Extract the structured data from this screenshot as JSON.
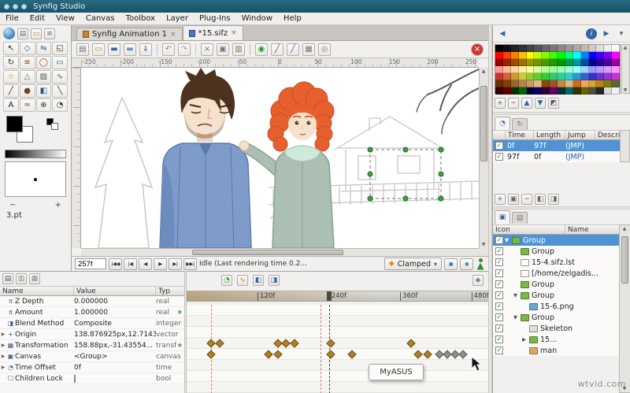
{
  "window": {
    "title": "Synfig Studio"
  },
  "colors": {
    "titlebar": "#1c5a70",
    "selection": "#4f93d6",
    "waypoint": "#b07f28",
    "waypoint_selected": "#8f8f8f",
    "group_icon": "#7ab648"
  },
  "menu": {
    "items": [
      "File",
      "Edit",
      "View",
      "Canvas",
      "Toolbox",
      "Layer",
      "Plug-Ins",
      "Window",
      "Help"
    ]
  },
  "canvas_tabs": [
    {
      "label": "Synfig Animation 1",
      "close": "×"
    },
    {
      "label": "*15.sifz",
      "close": "×"
    }
  ],
  "toolbox": {
    "actions": [
      {
        "name": "new-file",
        "glyph": "▤",
        "color": "#607080"
      },
      {
        "name": "open-file",
        "glyph": "▭",
        "color": "#c08830"
      },
      {
        "name": "settings",
        "glyph": "≡",
        "color": "#666666"
      }
    ],
    "tools": [
      {
        "name": "transform",
        "glyph": "↖",
        "color": "#222222"
      },
      {
        "name": "smooth-move",
        "glyph": "◇",
        "color": "#335588"
      },
      {
        "name": "mirror",
        "glyph": "⇋",
        "color": "#335588"
      },
      {
        "name": "scale",
        "glyph": "◱",
        "color": "#333333"
      },
      {
        "name": "rotate",
        "glyph": "↻",
        "color": "#333333"
      },
      {
        "name": "width",
        "glyph": "≡",
        "color": "#884422"
      },
      {
        "name": "circle",
        "glyph": "◯",
        "color": "#aa3322"
      },
      {
        "name": "rectangle",
        "glyph": "▭",
        "color": "#226688"
      },
      {
        "name": "star",
        "glyph": "☆",
        "color": "#bb8800"
      },
      {
        "name": "polygon",
        "glyph": "△",
        "color": "#557722"
      },
      {
        "name": "gradient",
        "glyph": "▨",
        "color": "#555555"
      },
      {
        "name": "spline",
        "glyph": "∿",
        "color": "#226688"
      },
      {
        "name": "draw",
        "glyph": "╱",
        "color": "#333333"
      },
      {
        "name": "brush",
        "glyph": "●",
        "color": "#774422"
      },
      {
        "name": "fill",
        "glyph": "◧",
        "color": "#225588"
      },
      {
        "name": "eyedrop",
        "glyph": "╲",
        "color": "#333333"
      },
      {
        "name": "text",
        "glyph": "A",
        "color": "#222222"
      },
      {
        "name": "sketch",
        "glyph": "≈",
        "color": "#555555"
      },
      {
        "name": "zoom",
        "glyph": "⊕",
        "color": "#333333"
      },
      {
        "name": "angle",
        "glyph": "◔",
        "color": "#333333"
      }
    ],
    "brush_size": "3.pt",
    "minus": "−",
    "plus": "+"
  },
  "canvas_toolbar": [
    {
      "name": "new",
      "glyph": "▤",
      "color": "#607080"
    },
    {
      "name": "open",
      "glyph": "▭",
      "color": "#c08830"
    },
    {
      "name": "save",
      "glyph": "▬",
      "color": "#3465a4"
    },
    {
      "name": "save-as",
      "glyph": "▬",
      "color": "#6a90c8"
    },
    {
      "name": "save-all",
      "glyph": "⇓",
      "color": "#3465a4"
    },
    {
      "sep": true
    },
    {
      "name": "undo",
      "glyph": "↶",
      "color": "#b08020"
    },
    {
      "name": "redo",
      "glyph": "↷",
      "color": "#999999"
    },
    {
      "sep": true
    },
    {
      "name": "cut",
      "glyph": "×",
      "color": "#777777"
    },
    {
      "name": "copy",
      "glyph": "▣",
      "color": "#777777"
    },
    {
      "name": "paste",
      "glyph": "▥",
      "color": "#8a6a40"
    },
    {
      "sep": true
    },
    {
      "name": "render",
      "glyph": "◉",
      "color": "#2f8f2f"
    },
    {
      "name": "draw-mode",
      "glyph": "╱",
      "color": "#a04848"
    },
    {
      "name": "edit-mode",
      "glyph": "╱",
      "color": "#3465a4"
    },
    {
      "name": "show-grid",
      "glyph": "▦",
      "color": "#777777"
    },
    {
      "name": "onion-skin",
      "glyph": "◎",
      "color": "#777777"
    },
    {
      "name": "close-view",
      "glyph": "×",
      "color": "#ffffff",
      "bg": "#cc3a2f",
      "round": true,
      "right": true
    }
  ],
  "rulers": {
    "horizontal": [
      "-250",
      "-200",
      "-150",
      "-100",
      "-50",
      "0",
      "50",
      "100",
      "150",
      "200",
      "250"
    ]
  },
  "timebar": {
    "time": "257f",
    "buttons": [
      "|◀◀",
      "|◀",
      "◀",
      "▶",
      "▶|",
      "▶▶|"
    ],
    "status": "Idle (Last rendering time 0.2...",
    "interpolation": "Clamped",
    "dropdown_arrow": "▾",
    "extra": [
      {
        "name": "render-options",
        "glyph": "▣",
        "color": "#3465a4"
      },
      {
        "name": "preview",
        "glyph": "◉",
        "color": "#3465a4"
      }
    ]
  },
  "params": {
    "actions": [
      {
        "name": "params-tab",
        "glyph": "▤",
        "color": "#555555"
      },
      {
        "name": "children-tab",
        "glyph": "▥",
        "color": "#888888"
      },
      {
        "name": "misc-tab",
        "glyph": "▦",
        "color": "#888888"
      }
    ],
    "headers": [
      "Name",
      "Value",
      "Typ"
    ],
    "rows": [
      {
        "exp": false,
        "icon": "π",
        "name": "Z Depth",
        "value": "0.000000",
        "type": "real"
      },
      {
        "exp": false,
        "icon": "π",
        "name": "Amount",
        "value": "1.000000",
        "type": "real",
        "mark": "∗"
      },
      {
        "exp": false,
        "icon": "◨",
        "name": "Blend Method",
        "value": "Composite",
        "type": "integer"
      },
      {
        "exp": true,
        "icon": "+",
        "name": "Origin",
        "value": "138.876925px,12.714375",
        "type": "vector"
      },
      {
        "exp": true,
        "icon": "▦",
        "name": "Transformation",
        "value": "158.88px,-31.43554...",
        "type": "transformation",
        "mark": "∗"
      },
      {
        "exp": true,
        "icon": "▣",
        "name": "Canvas",
        "value": "<Group>",
        "type": "canvas"
      },
      {
        "exp": true,
        "icon": "◔",
        "name": "Time Offset",
        "value": "0f",
        "type": "time"
      },
      {
        "exp": false,
        "icon": "☐",
        "name": "Children Lock",
        "value": "",
        "type": "bool",
        "checkbox": true
      }
    ]
  },
  "timetrack": {
    "icons": [
      {
        "name": "time-mode",
        "glyph": "◔",
        "color": "#2f8f2f"
      },
      {
        "name": "curves",
        "glyph": "∿",
        "color": "#cc6622"
      },
      {
        "name": "past-onion",
        "glyph": "◧",
        "color": "#3465a4"
      },
      {
        "name": "future-onion",
        "glyph": "◨",
        "color": "#3465a4"
      }
    ],
    "right_icon": {
      "name": "keyframe-lock",
      "glyph": "◆",
      "color": "#888888"
    },
    "ticks": [
      {
        "label": "120f",
        "pos": 0.235
      },
      {
        "label": "240f",
        "pos": 0.472
      },
      {
        "label": "360f",
        "pos": 0.708
      },
      {
        "label": "480f",
        "pos": 0.944
      }
    ],
    "cursor_pos": 0.472,
    "guides": [
      {
        "pos": 0.081
      },
      {
        "pos": 0.445
      }
    ],
    "rows": 8,
    "keyframes": [
      {
        "row": 3,
        "pos": 0.081
      },
      {
        "row": 3,
        "pos": 0.11
      },
      {
        "row": 3,
        "pos": 0.303
      },
      {
        "row": 3,
        "pos": 0.33
      },
      {
        "row": 3,
        "pos": 0.357
      },
      {
        "row": 3,
        "pos": 0.478
      },
      {
        "row": 3,
        "pos": 0.744
      },
      {
        "row": 4,
        "pos": 0.081
      },
      {
        "row": 4,
        "pos": 0.272
      },
      {
        "row": 4,
        "pos": 0.303
      },
      {
        "row": 4,
        "pos": 0.478
      },
      {
        "row": 4,
        "pos": 0.548
      },
      {
        "row": 4,
        "pos": 0.768
      },
      {
        "row": 4,
        "pos": 0.799
      },
      {
        "row": 4,
        "pos": 0.838,
        "gray": true
      },
      {
        "row": 4,
        "pos": 0.864,
        "gray": true
      },
      {
        "row": 4,
        "pos": 0.89,
        "gray": true
      },
      {
        "row": 4,
        "pos": 0.916,
        "gray": true
      }
    ]
  },
  "dock_nav": [
    {
      "name": "scroll-left",
      "glyph": "◀",
      "color": "#3465a4"
    },
    {
      "name": "panel-info",
      "glyph": "i",
      "color": "#ffffff",
      "bg": "#3465a4",
      "round": true
    },
    {
      "name": "scroll-right",
      "glyph": "▶",
      "color": "#3465a4"
    },
    {
      "name": "panel-menu",
      "glyph": "▾",
      "color": "#555555"
    }
  ],
  "palette": {
    "colors": [
      [
        "#000000",
        "#111111",
        "#222222",
        "#333333",
        "#444444",
        "#555555",
        "#666666",
        "#777777",
        "#888888",
        "#999999",
        "#aaaaaa",
        "#bbbbbb",
        "#cccccc",
        "#dddddd",
        "#eeeeee",
        "#ffffff"
      ],
      [
        "#ff0000",
        "#ff4000",
        "#ff8000",
        "#ffbf00",
        "#ffff00",
        "#bfff00",
        "#80ff00",
        "#40ff00",
        "#00ff00",
        "#00ff80",
        "#00ffff",
        "#0080ff",
        "#0000ff",
        "#4000ff",
        "#8000ff",
        "#ff00ff"
      ],
      [
        "#990000",
        "#992600",
        "#994d00",
        "#997300",
        "#999900",
        "#739900",
        "#4d9900",
        "#269900",
        "#009900",
        "#00994d",
        "#009999",
        "#004d99",
        "#000099",
        "#260099",
        "#4d0099",
        "#990099"
      ],
      [
        "#ff9999",
        "#ffb999",
        "#ffd999",
        "#fff299",
        "#ffff99",
        "#d9ff99",
        "#b9ff99",
        "#99ff99",
        "#99ffb9",
        "#99ffd9",
        "#99ffff",
        "#99d9ff",
        "#9999ff",
        "#b999ff",
        "#d999ff",
        "#ff99ff"
      ],
      [
        "#cc3333",
        "#cc6633",
        "#cc9933",
        "#cccc33",
        "#99cc33",
        "#66cc33",
        "#33cc33",
        "#33cc66",
        "#33cc99",
        "#33cccc",
        "#3399cc",
        "#3366cc",
        "#3333cc",
        "#6633cc",
        "#9933cc",
        "#cc33cc"
      ],
      [
        "#663300",
        "#804000",
        "#996633",
        "#b38059",
        "#cc9966",
        "#e6b380",
        "#8b4513",
        "#a0522d",
        "#cd853f",
        "#deb887",
        "#d2691e",
        "#f4a460",
        "#daa520",
        "#b8860b",
        "#808000",
        "#556b2f"
      ],
      [
        "#330000",
        "#660000",
        "#003300",
        "#006600",
        "#000033",
        "#000066",
        "#330033",
        "#660066",
        "#003333",
        "#006666",
        "#333300",
        "#666600",
        "#4d4d4d",
        "#262626",
        "#d9d9d9",
        "#f2f2f2"
      ]
    ],
    "actions": [
      {
        "name": "add-color",
        "glyph": "+",
        "color": "#2d7d2d"
      },
      {
        "name": "remove-color",
        "glyph": "−",
        "color": "#aa3333"
      },
      {
        "name": "load-palette",
        "glyph": "▲",
        "color": "#3465a4"
      },
      {
        "name": "save-palette",
        "glyph": "▼",
        "color": "#3465a4"
      },
      {
        "name": "default-palette",
        "glyph": "◩",
        "color": "#555555"
      }
    ]
  },
  "keyframes": {
    "tabs": [
      {
        "name": "keyframes-panel",
        "glyph": "◔",
        "color": "#3465a4",
        "active": true
      },
      {
        "name": "history-panel",
        "glyph": "↻",
        "color": "#777777",
        "active": false
      }
    ],
    "headers": [
      "Time",
      "Length",
      "Jump",
      "Descri"
    ],
    "rows": [
      {
        "checked": true,
        "time": "0f",
        "length": "97f",
        "jump": "(JMP)",
        "selected": true
      },
      {
        "checked": true,
        "time": "97f",
        "length": "0f",
        "jump": "(JMP)",
        "selected": false
      }
    ],
    "actions": [
      {
        "name": "add-keyframe",
        "glyph": "+",
        "color": "#3465a4"
      },
      {
        "name": "duplicate-keyframe",
        "glyph": "▣",
        "color": "#666666"
      },
      {
        "name": "remove-keyframe",
        "glyph": "−",
        "color": "#aa3333"
      },
      {
        "name": "lock-past",
        "glyph": "◧",
        "color": "#666666"
      },
      {
        "name": "lock-future",
        "glyph": "◨",
        "color": "#666666"
      }
    ]
  },
  "layers": {
    "tabs": [
      {
        "name": "layers-panel",
        "glyph": "▣",
        "color": "#3465a4",
        "active": true
      },
      {
        "name": "library-panel",
        "glyph": "▤",
        "color": "#777777",
        "active": false
      }
    ],
    "headers": [
      "Icon",
      "Name"
    ],
    "rows": [
      {
        "indent": 0,
        "exp": "▼",
        "icon": "group",
        "name": "Group",
        "checked": true,
        "selected": true
      },
      {
        "indent": 1,
        "exp": "",
        "icon": "group",
        "name": "Group",
        "checked": true
      },
      {
        "indent": 1,
        "exp": "",
        "icon": "doc",
        "name": "15-4.sifz.lst",
        "checked": true
      },
      {
        "indent": 1,
        "exp": "",
        "icon": "doc",
        "name": "[/home/zelgadis...",
        "checked": true
      },
      {
        "indent": 1,
        "exp": "",
        "icon": "group",
        "name": "Group",
        "checked": true
      },
      {
        "indent": 1,
        "exp": "▼",
        "icon": "group",
        "name": "Group",
        "checked": true
      },
      {
        "indent": 2,
        "exp": "",
        "icon": "image",
        "name": "15-6.png",
        "checked": true
      },
      {
        "indent": 1,
        "exp": "▼",
        "icon": "group",
        "name": "Group",
        "checked": true
      },
      {
        "indent": 2,
        "exp": "",
        "icon": "skeleton",
        "name": "Skeleton",
        "checked": true
      },
      {
        "indent": 2,
        "exp": "▶",
        "icon": "group",
        "name": "15...",
        "checked": true
      },
      {
        "indent": 2,
        "exp": "",
        "icon": "man",
        "name": "man",
        "checked": true
      }
    ]
  },
  "tooltip": "MyASUS",
  "watermark": "wtvid.com"
}
